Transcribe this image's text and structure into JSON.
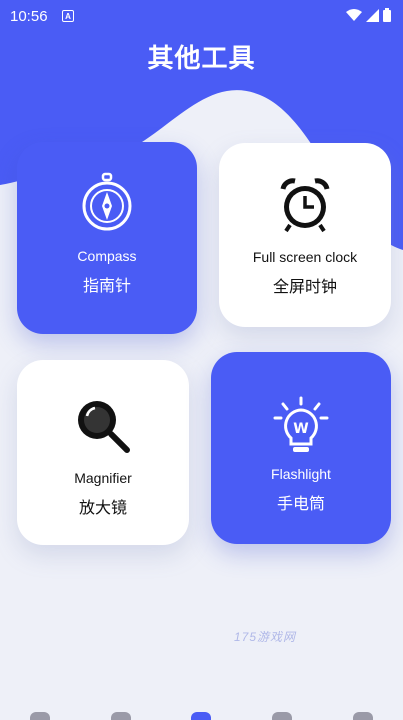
{
  "status_bar": {
    "time": "10:56"
  },
  "page": {
    "title": "其他工具"
  },
  "tools": [
    {
      "label_en": "Compass",
      "label_zh": "指南针",
      "icon": "compass-icon"
    },
    {
      "label_en": "Full screen clock",
      "label_zh": "全屏时钟",
      "icon": "alarm-clock-icon"
    },
    {
      "label_en": "Magnifier",
      "label_zh": "放大镜",
      "icon": "magnifier-icon"
    },
    {
      "label_en": "Flashlight",
      "label_zh": "手电筒",
      "icon": "lightbulb-icon"
    }
  ],
  "watermark": "175游戏网",
  "colors": {
    "accent": "#4a5cf5",
    "background": "#eef0f8",
    "card_white": "#ffffff"
  }
}
